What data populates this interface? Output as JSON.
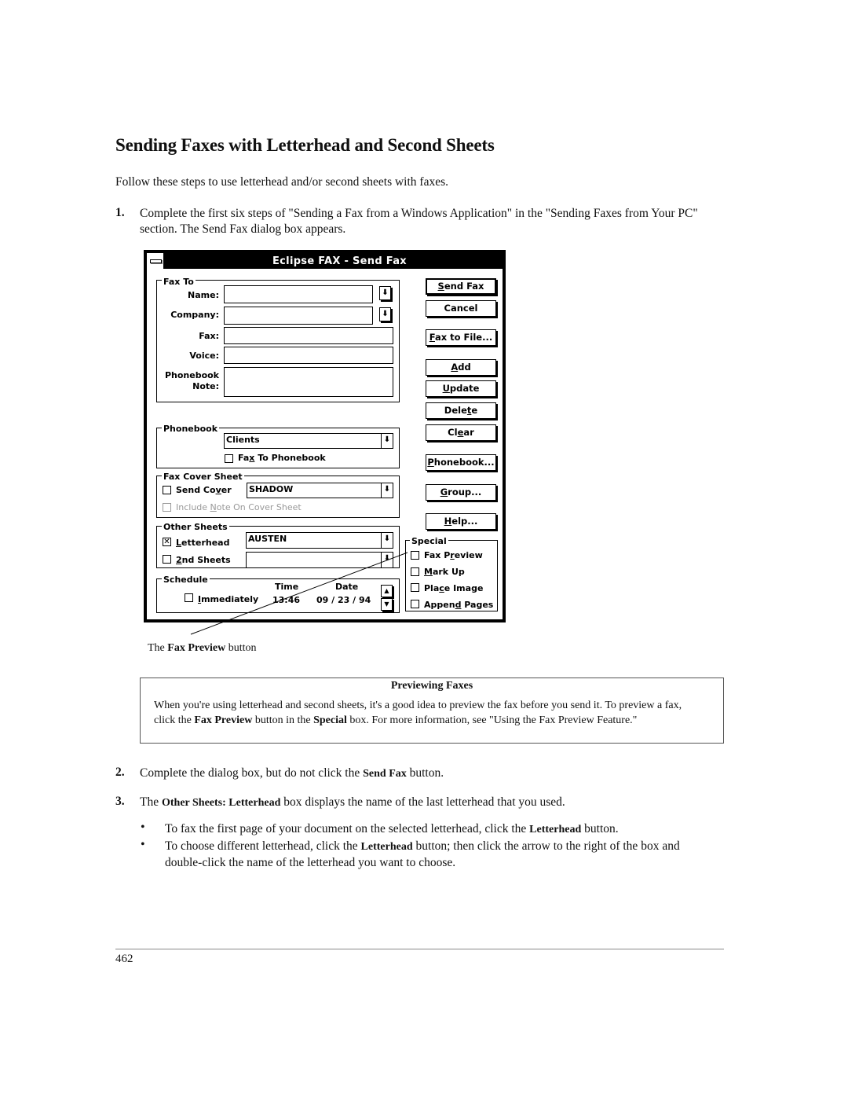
{
  "heading": "Sending Faxes with Letterhead and Second Sheets",
  "intro": "Follow these steps to use letterhead and/or second sheets with faxes.",
  "steps": [
    {
      "number": "1.",
      "text": "Complete the first six steps of  \"Sending a Fax from a Windows Application\" in the \"Sending Faxes from Your PC\" section. The Send Fax dialog box appears."
    },
    {
      "number": "2.",
      "text_before": "Complete the dialog box, but do not click the ",
      "bold": "Send Fax",
      "text_after": " button."
    },
    {
      "number": "3.",
      "text_before": "The ",
      "bold": "Other Sheets: Letterhead",
      "text_after": " box displays the name of the last letterhead that you used."
    }
  ],
  "bullets": [
    {
      "symbol": "•",
      "text_before": "To fax the first page of your document on the selected letterhead, click the ",
      "bold": "Letterhead",
      "text_after": " button."
    },
    {
      "symbol": "•",
      "text_before": "To choose different letterhead, click the ",
      "bold": "Letterhead",
      "text_after": " button; then click the arrow to the right of the box and double-click the name of the letterhead you want to choose."
    }
  ],
  "dialog": {
    "title": "Eclipse FAX - Send Fax",
    "fax_to": {
      "group_label": "Fax To",
      "name_label": "Name:",
      "name_value": "",
      "company_label": "Company:",
      "company_value": "",
      "fax_label": "Fax:",
      "fax_value": "",
      "voice_label": "Voice:",
      "voice_value": "",
      "note_label_1": "Phonebook",
      "note_label_2": "Note:",
      "note_value": ""
    },
    "phonebook": {
      "group_label": "Phonebook",
      "selected": "Clients",
      "fax_to_phonebook_pre": "Fa",
      "fax_to_phonebook_u": "x",
      "fax_to_phonebook_post": " To Phonebook",
      "fax_to_phonebook_checked": false
    },
    "cover_sheet": {
      "group_label": "Fax Cover Sheet",
      "send_cover_pre": "Send Co",
      "send_cover_u": "v",
      "send_cover_post": "er",
      "send_cover_checked": false,
      "cover_selected": "SHADOW",
      "include_note_pre": "Include ",
      "include_note_u": "N",
      "include_note_post": "ote On Cover Sheet",
      "include_note_enabled": false
    },
    "other_sheets": {
      "group_label": "Other Sheets",
      "letterhead_u": "L",
      "letterhead_post": "etterhead",
      "letterhead_checked": true,
      "letterhead_selected": "AUSTEN",
      "second_u": "2",
      "second_post": "nd Sheets",
      "second_checked": false,
      "second_selected": ""
    },
    "schedule": {
      "group_label": "Schedule",
      "immediately_u": "I",
      "immediately_post": "mmediately",
      "immediately_checked": false,
      "time_label": "Time",
      "date_label": "Date",
      "time_value": "13:46",
      "date_value": "09 / 23 / 94"
    },
    "buttons": [
      {
        "pre": "",
        "u": "S",
        "post": "end Fax"
      },
      {
        "pre": "Cancel",
        "u": "",
        "post": ""
      },
      {
        "pre": "",
        "u": "F",
        "post": "ax to File..."
      },
      {
        "pre": "",
        "u": "A",
        "post": "dd"
      },
      {
        "pre": "",
        "u": "U",
        "post": "pdate"
      },
      {
        "pre": "Dele",
        "u": "t",
        "post": "e"
      },
      {
        "pre": "Cl",
        "u": "e",
        "post": "ar"
      },
      {
        "pre": "",
        "u": "P",
        "post": "honebook..."
      },
      {
        "pre": "",
        "u": "G",
        "post": "roup..."
      },
      {
        "pre": "",
        "u": "H",
        "post": "elp..."
      }
    ],
    "special": {
      "group_label": "Special",
      "items": [
        {
          "pre": "Fax P",
          "u": "r",
          "post": "eview",
          "checked": false
        },
        {
          "pre": "",
          "u": "M",
          "post": "ark Up",
          "checked": false
        },
        {
          "pre": "Pla",
          "u": "c",
          "post": "e Image",
          "checked": false
        },
        {
          "pre": "Appen",
          "u": "d",
          "post": " Pages",
          "checked": false
        }
      ]
    },
    "icons": {
      "dropdown_arrow": "⬇",
      "spin_up": "▲",
      "spin_down": "▼",
      "checked_mark": "✕"
    }
  },
  "caption": {
    "pre": "The ",
    "bold": "Fax Preview",
    "post": " button"
  },
  "note": {
    "title": "Previewing Faxes",
    "t1": "When you're using letterhead and second sheets, it's a good idea to preview the fax before you send it. To preview a fax, click the ",
    "b1": "Fax Preview",
    "t2": " button in the ",
    "b2": "Special",
    "t3": " box. For more information, see \"Using the Fax Preview Feature.\""
  },
  "page_number": "462"
}
